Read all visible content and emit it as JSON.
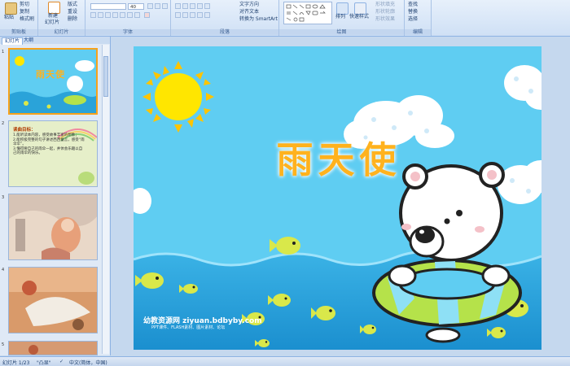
{
  "ribbon": {
    "groups": {
      "clipboard": {
        "label": "剪贴板",
        "paste": "粘贴",
        "cut": "剪切",
        "copy": "复制",
        "format_painter": "格式刷"
      },
      "slides": {
        "label": "幻灯片",
        "new_slide": "新建",
        "new_slide_2": "幻灯片",
        "layout": "版式",
        "reset": "重设",
        "delete": "删除"
      },
      "font": {
        "label": "字体",
        "font_size": "40"
      },
      "paragraph": {
        "label": "段落",
        "text_direction": "文字方向",
        "align_text": "对齐文本",
        "smartart": "转换为 SmartArt"
      },
      "drawing": {
        "label": "绘图",
        "arrange": "排列",
        "quick_styles": "快速样式",
        "shape_fill": "形状填充",
        "shape_outline": "形状轮廓",
        "shape_effects": "形状效果"
      },
      "editing": {
        "label": "编辑",
        "find": "查找",
        "replace": "替换",
        "select": "选择"
      }
    }
  },
  "left_pane": {
    "tabs": [
      "幻灯片",
      "大纲"
    ],
    "thumbnails": [
      {
        "num": "1",
        "title": "雨天使"
      },
      {
        "num": "2",
        "heading": "读曲目标：",
        "lines": [
          "1.能听读本内容，感受故事丰富的想象；",
          "2.能积极完整的句子讲述西西童言，感受“雨伞伞”。",
          "3.懂得要自己的雨伞一起，并体会乐趣以自己的雨伞的快乐。"
        ]
      },
      {
        "num": "3"
      },
      {
        "num": "4"
      },
      {
        "num": "5"
      }
    ]
  },
  "slide": {
    "title": "雨天使",
    "watermark_main": "幼教资源网 ziyuan.bdbyby.com",
    "watermark_sub": "PPT课件、FLASH素材、图片素材、论坛"
  },
  "status": {
    "slide_counter": "幻灯片 1/23",
    "theme": "\"凸显\"",
    "language": "中文(简体，中国)"
  },
  "colors": {
    "sky": "#5fcdf2",
    "sea": "#2aa3d9",
    "title": "#ffb21e",
    "selection": "#f7a21b"
  }
}
